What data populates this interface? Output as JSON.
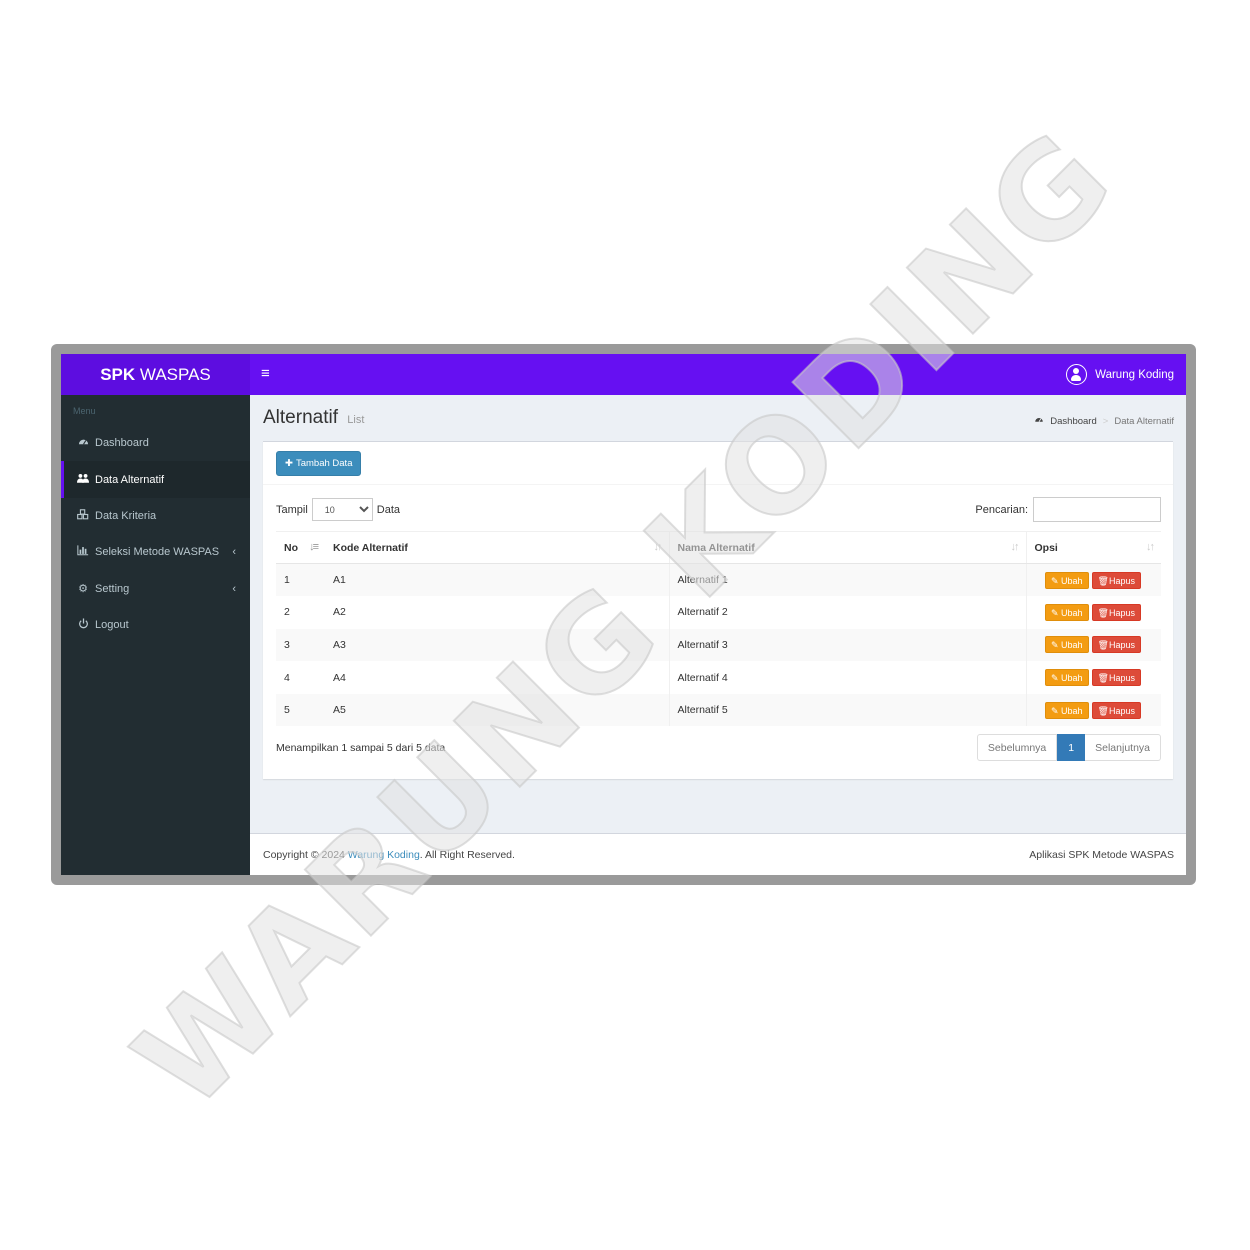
{
  "app": {
    "logo_bold": "SPK",
    "logo_rest": "WASPAS",
    "user_name": "Warung Koding",
    "hamburger": "≡"
  },
  "sidebar": {
    "header": "Menu",
    "items": [
      {
        "label": "Dashboard",
        "icon": "dashboard-icon"
      },
      {
        "label": "Data Alternatif",
        "icon": "users-icon",
        "active": true
      },
      {
        "label": "Data Kriteria",
        "icon": "cubes-icon"
      },
      {
        "label": "Seleksi Metode WASPAS",
        "icon": "bar-chart-icon",
        "has_children": true
      },
      {
        "label": "Setting",
        "icon": "gear-icon",
        "has_children": true
      },
      {
        "label": "Logout",
        "icon": "power-icon"
      }
    ]
  },
  "page": {
    "title": "Alternatif",
    "subtitle": "List",
    "breadcrumb": [
      "Dashboard",
      "Data Alternatif"
    ]
  },
  "toolbar": {
    "add_label": "Tambah Data"
  },
  "datatable": {
    "length_prefix": "Tampil",
    "length_value": "10",
    "length_suffix": "Data",
    "search_label": "Pencarian:",
    "search_value": "",
    "columns": [
      "No",
      "Kode Alternatif",
      "Nama Alternatif",
      "Opsi"
    ],
    "rows": [
      {
        "no": "1",
        "kode": "A1",
        "nama": "Alternatif 1"
      },
      {
        "no": "2",
        "kode": "A2",
        "nama": "Alternatif 2"
      },
      {
        "no": "3",
        "kode": "A3",
        "nama": "Alternatif 3"
      },
      {
        "no": "4",
        "kode": "A4",
        "nama": "Alternatif 4"
      },
      {
        "no": "5",
        "kode": "A5",
        "nama": "Alternatif 5"
      }
    ],
    "edit_label": "Ubah",
    "delete_label": "Hapus",
    "info": "Menampilkan 1 sampai 5 dari 5 data",
    "prev_label": "Sebelumnya",
    "current_page": "1",
    "next_label": "Selanjutnya"
  },
  "footer": {
    "prefix": "Copyright © 2024 ",
    "link": "Warung Koding",
    "suffix": ". All Right Reserved.",
    "right": "Aplikasi SPK Metode WASPAS"
  },
  "watermark": "WARUNG KODING",
  "colors": {
    "header": "#6610f2",
    "sidebar": "#222d32",
    "primary": "#3c8dbc",
    "warning": "#f39c12",
    "danger": "#dd4b39"
  }
}
